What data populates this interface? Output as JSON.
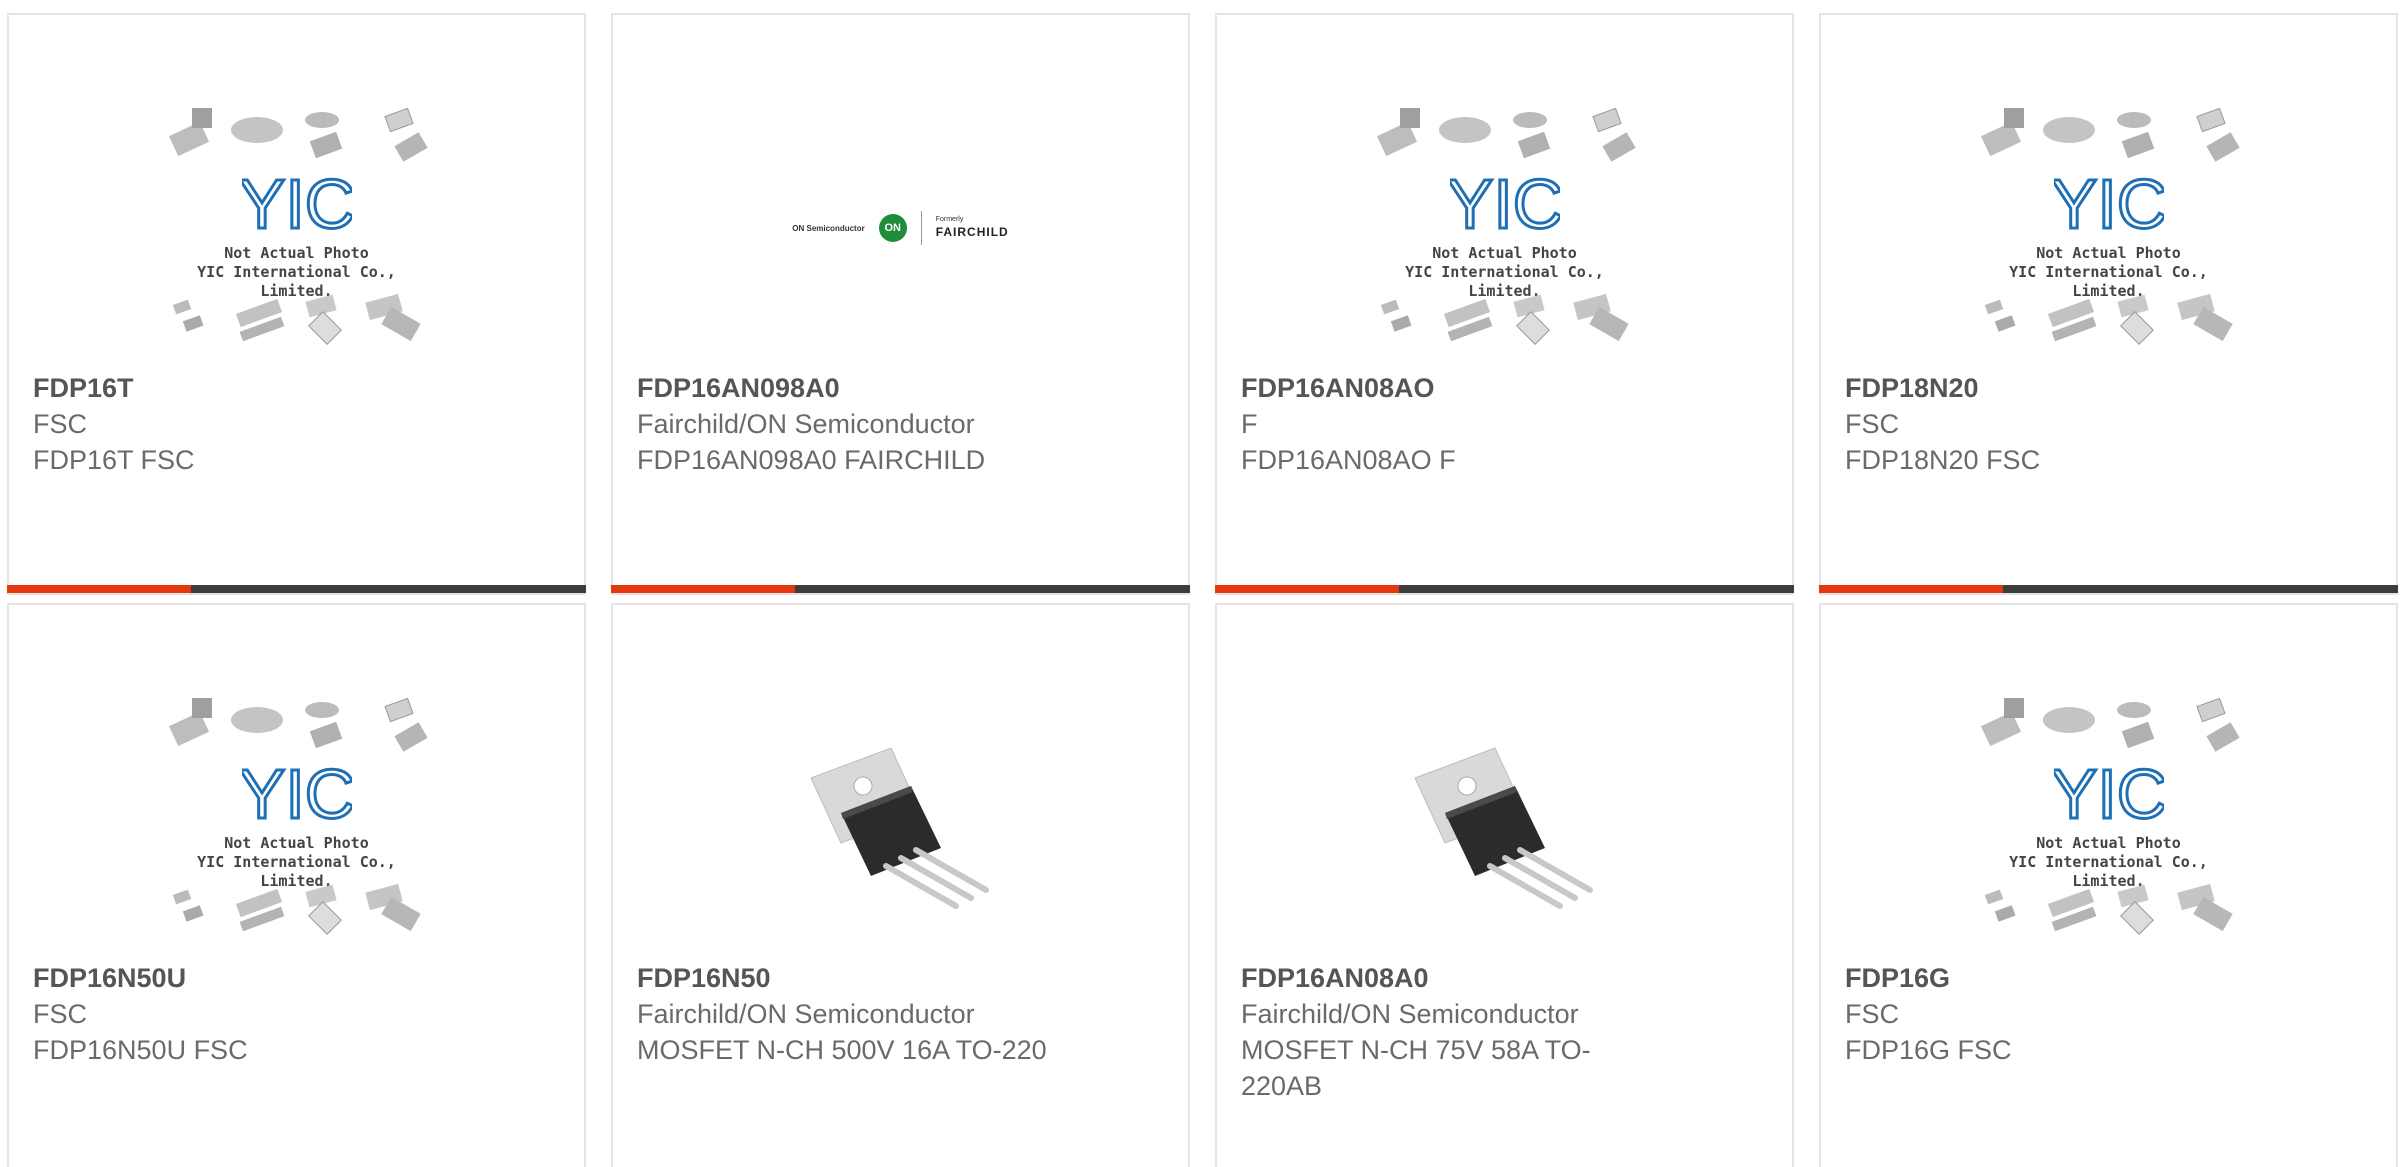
{
  "products": [
    {
      "part": "FDP16T",
      "manufacturer": "FSC",
      "description": "FDP16T FSC",
      "image": "placeholder"
    },
    {
      "part": "FDP16AN098A0",
      "manufacturer": "Fairchild/ON Semiconductor",
      "description": "FDP16AN098A0 FAIRCHILD",
      "image": "brand-logo"
    },
    {
      "part": "FDP16AN08AO",
      "manufacturer": "F",
      "description": "FDP16AN08AO F",
      "image": "placeholder"
    },
    {
      "part": "FDP18N20",
      "manufacturer": "FSC",
      "description": "FDP18N20 FSC",
      "image": "placeholder"
    },
    {
      "part": "FDP16N50U",
      "manufacturer": "FSC",
      "description": "FDP16N50U FSC",
      "image": "placeholder"
    },
    {
      "part": "FDP16N50",
      "manufacturer": "Fairchild/ON Semiconductor",
      "description": "MOSFET N-CH 500V 16A TO-220",
      "image": "mosfet"
    },
    {
      "part": "FDP16AN08A0",
      "manufacturer": "Fairchild/ON Semiconductor",
      "description": "MOSFET N-CH 75V 58A TO-220AB",
      "image": "mosfet"
    },
    {
      "part": "FDP16G",
      "manufacturer": "FSC",
      "description": "FDP16G FSC",
      "image": "placeholder"
    }
  ],
  "placeholder": {
    "logo_text": "YIC",
    "caption_line1": "Not Actual Photo",
    "caption_line2": "YIC International Co., Limited."
  },
  "brand_logo": {
    "on_text": "ON Semiconductor",
    "on_badge": "ON",
    "formerly": "Formerly",
    "fairchild": "FAIRCHILD"
  },
  "colors": {
    "accent": "#e5380c",
    "bar": "#3d3d3d",
    "yic_blue": "#1f6fb5",
    "on_green": "#1e8c3a"
  }
}
